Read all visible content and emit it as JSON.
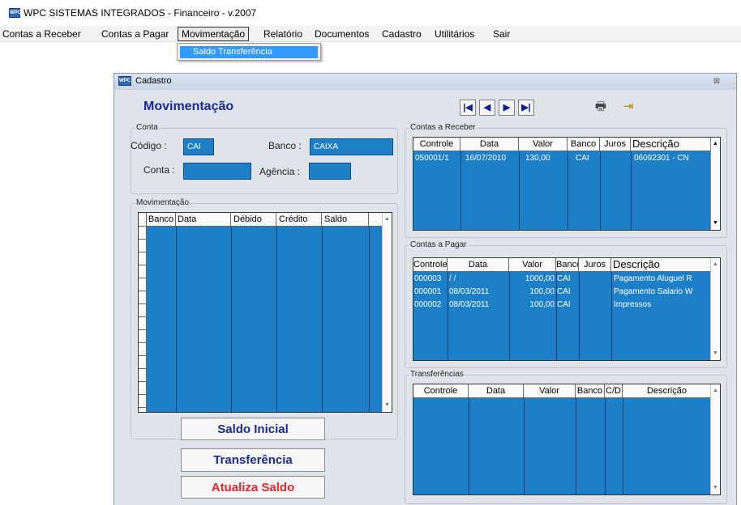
{
  "app": {
    "title": "WPC SISTEMAS INTEGRADOS - Financeiro - v.2007",
    "logo_text": "WPC"
  },
  "menu": [
    "Contas a Receber",
    "Contas a Pagar",
    "Movimentação",
    "Relatório",
    "Documentos",
    "Cadastro",
    "Utilitários",
    "Sair"
  ],
  "dropdown": {
    "item": "Saldo Transferência"
  },
  "window": {
    "title": "Cadastro",
    "close": "⊠",
    "icon_text": "WPC"
  },
  "heading": "Movimentação",
  "nav": {
    "first": "|◀",
    "prev": "◀",
    "next": "▶",
    "last": "▶|",
    "print": "🖶",
    "exit": "⇥"
  },
  "conta": {
    "label": "Conta",
    "codigo_label": "Código :",
    "codigo_value": "CAI",
    "banco_label": "Banco :",
    "banco_value": "CAIXA",
    "conta_label": "Conta :",
    "conta_value": "",
    "agencia_label": "Agência :",
    "agencia_value": ""
  },
  "movimentacao": {
    "label": "Movimentação",
    "columns": [
      "Banco",
      "Data",
      "Débido",
      "Crédito",
      "Saldo"
    ]
  },
  "receber": {
    "label": "Contas a Receber",
    "columns": [
      "Controle",
      "Data",
      "Valor",
      "Banco",
      "Juros",
      "Descrição"
    ],
    "rows": [
      {
        "controle": "050001/1",
        "data": "16/07/2010",
        "valor": "130,00",
        "banco": "CAI",
        "juros": "",
        "descricao": "06092301 - CN"
      }
    ]
  },
  "pagar": {
    "label": "Contas a Pagar",
    "columns": [
      "Controle",
      "Data",
      "Valor",
      "Banco",
      "Juros",
      "Descrição"
    ],
    "rows": [
      {
        "controle": "000003",
        "data": "/ /",
        "valor": "1000,00",
        "banco": "CAI",
        "juros": "",
        "descricao": "Pagamento Aluguel R"
      },
      {
        "controle": "000001",
        "data": "08/03/2011",
        "valor": "100,00",
        "banco": "CAI",
        "juros": "",
        "descricao": "Pagamento Salario W"
      },
      {
        "controle": "000002",
        "data": "08/03/2011",
        "valor": "100,00",
        "banco": "CAI",
        "juros": "",
        "descricao": "Impressos"
      }
    ]
  },
  "transferencias": {
    "label": "Transferências",
    "columns": [
      "Controle",
      "Data",
      "Valor",
      "Banco",
      "C/D",
      "Descrição"
    ]
  },
  "buttons": {
    "saldo_inicial": "Saldo Inicial",
    "transferencia": "Transferência",
    "atualiza_saldo": "Atualiza Saldo"
  }
}
